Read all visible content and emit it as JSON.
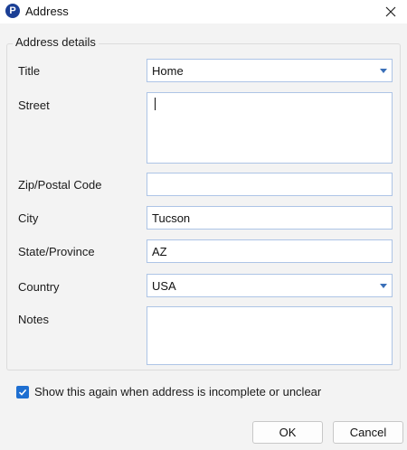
{
  "window": {
    "title": "Address",
    "app_icon_letter": "P",
    "app_icon": "app-logo-icon",
    "close_icon": "close-icon"
  },
  "group": {
    "legend": "Address details"
  },
  "form": {
    "title": {
      "label": "Title",
      "value": "Home"
    },
    "street": {
      "label": "Street",
      "value": ""
    },
    "zip": {
      "label": "Zip/Postal Code",
      "value": ""
    },
    "city": {
      "label": "City",
      "value": "Tucson"
    },
    "state": {
      "label": "State/Province",
      "value": "AZ"
    },
    "country": {
      "label": "Country",
      "value": "USA"
    },
    "notes": {
      "label": "Notes",
      "value": ""
    }
  },
  "checkbox": {
    "label": "Show this again when address is incomplete or unclear",
    "checked": true
  },
  "buttons": {
    "ok": "OK",
    "cancel": "Cancel"
  },
  "colors": {
    "accent": "#1e6fd1",
    "field_border": "#adc4e6",
    "app_icon_bg": "#1b3f95"
  }
}
